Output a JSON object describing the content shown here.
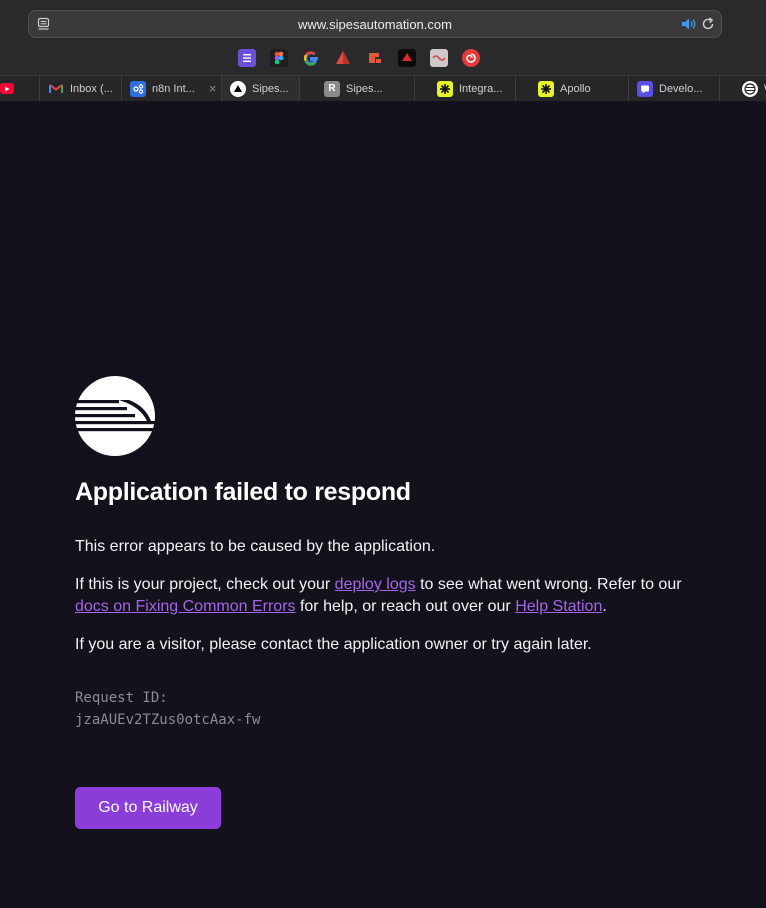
{
  "browser": {
    "url": "www.sipesautomation.com",
    "bookmarks": [
      "notes-icon",
      "figma-icon",
      "google-icon",
      "pyramid-icon",
      "red-tool-icon",
      "dark-app-icon",
      "link-icon",
      "swirl-icon"
    ],
    "tabs": [
      {
        "label": "",
        "icon": "youtube-icon"
      },
      {
        "label": "Inbox (...",
        "icon": "gmail-icon"
      },
      {
        "label": "n8n Int...",
        "icon": "n8n-icon"
      },
      {
        "label": "Sipes...",
        "icon": "railway-icon",
        "active": true
      },
      {
        "label": "Sipes...",
        "icon": "r-icon"
      },
      {
        "label": "Integra...",
        "icon": "integration-icon"
      },
      {
        "label": "Apollo",
        "icon": "apollo-icon"
      },
      {
        "label": "Develo...",
        "icon": "developer-icon"
      },
      {
        "label": "W",
        "icon": "w-icon"
      }
    ]
  },
  "page": {
    "title": "Application failed to respond",
    "p1": "This error appears to be caused by the application.",
    "p2_a": "If this is your project, check out your ",
    "p2_link1": "deploy logs",
    "p2_b": " to see what went wrong. Refer to our ",
    "p2_link2": "docs on Fixing Common Errors",
    "p2_c": " for help, or reach out over our ",
    "p2_link3": "Help Station",
    "p2_d": ".",
    "p3": "If you are a visitor, please contact the application owner or try again later.",
    "request_label": "Request ID:",
    "request_id": "jzaAUEv2TZus0otcAax-fw",
    "button": "Go to Railway"
  },
  "colors": {
    "background": "#13111c",
    "link": "#a565e8",
    "button": "#8b3dd9"
  }
}
